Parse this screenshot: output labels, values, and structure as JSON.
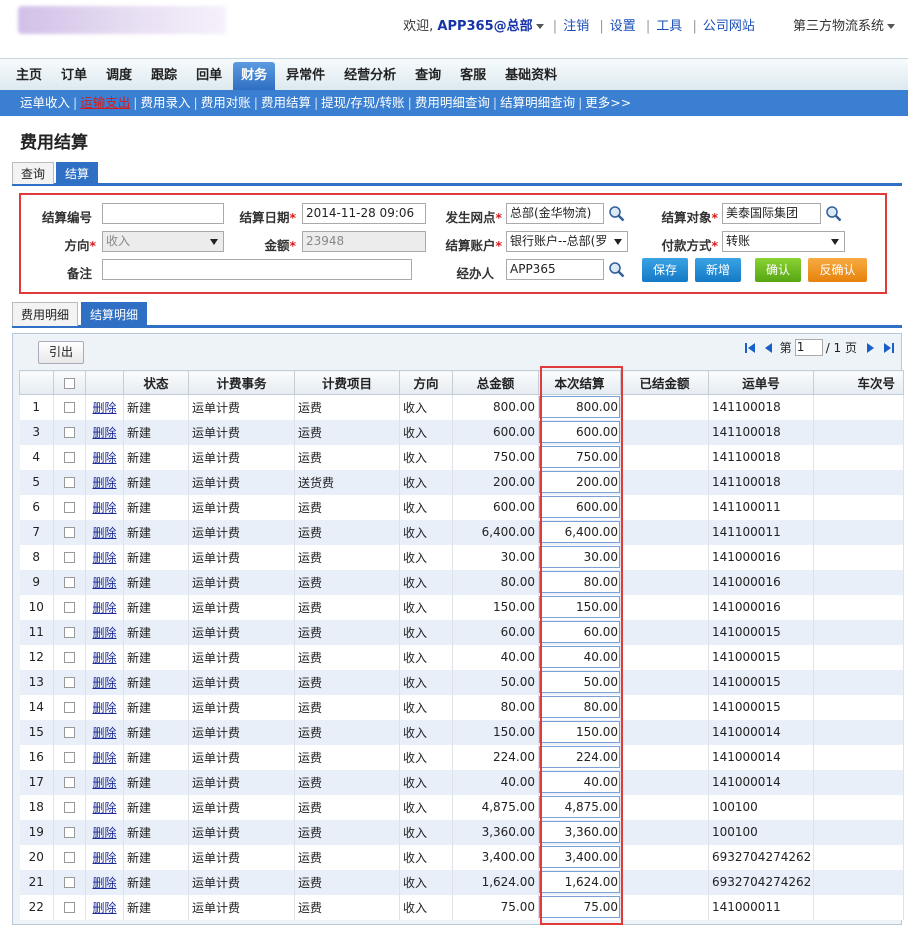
{
  "header": {
    "welcome": "欢迎,",
    "user": "APP365@总部",
    "links": [
      "注销",
      "设置",
      "工具",
      "公司网站"
    ],
    "system_menu": "第三方物流系统"
  },
  "nav": {
    "items": [
      "主页",
      "订单",
      "调度",
      "跟踪",
      "回单",
      "财务",
      "异常件",
      "经营分析",
      "查询",
      "客服",
      "基础资料"
    ],
    "active": "财务"
  },
  "subnav": {
    "items": [
      "运单收入",
      "运输支出",
      "费用录入",
      "费用对账",
      "费用结算",
      "提现/存现/转账",
      "费用明细查询",
      "结算明细查询"
    ],
    "active": "运输支出",
    "more": "更多>>"
  },
  "page_title": "费用结算",
  "tabs_top": [
    "查询",
    "结算"
  ],
  "form": {
    "settle_no": {
      "label": "结算编号",
      "value": ""
    },
    "settle_date": {
      "label": "结算日期",
      "value": "2014-11-28 09:06"
    },
    "branch": {
      "label": "发生网点",
      "value": "总部(金华物流)"
    },
    "target": {
      "label": "结算对象",
      "value": "美泰国际集团"
    },
    "direction": {
      "label": "方向",
      "value": "收入"
    },
    "amount": {
      "label": "金额",
      "value": "23948"
    },
    "account": {
      "label": "结算账户",
      "value": "银行账户--总部(罗"
    },
    "pay_method": {
      "label": "付款方式",
      "value": "转账"
    },
    "remark": {
      "label": "备注",
      "value": ""
    },
    "handler": {
      "label": "经办人",
      "value": "APP365"
    },
    "buttons": {
      "save": "保存",
      "add": "新增",
      "confirm": "确认",
      "unconfirm": "反确认"
    }
  },
  "tabs_bottom": [
    "费用明细",
    "结算明细"
  ],
  "grid": {
    "export_label": "引出",
    "pager": {
      "prefix": "第",
      "page": "1",
      "suffix": "/ 1 页"
    },
    "columns": [
      "状态",
      "计费事务",
      "计费项目",
      "方向",
      "总金额",
      "本次结算",
      "已结金额",
      "运单号",
      "车次号"
    ],
    "delete_label": "删除",
    "rows": [
      [
        "1",
        "新建",
        "运单计费",
        "运费",
        "收入",
        "800.00",
        "800.00",
        "",
        "141100018"
      ],
      [
        "3",
        "新建",
        "运单计费",
        "运费",
        "收入",
        "600.00",
        "600.00",
        "",
        "141100018"
      ],
      [
        "4",
        "新建",
        "运单计费",
        "运费",
        "收入",
        "750.00",
        "750.00",
        "",
        "141100018"
      ],
      [
        "5",
        "新建",
        "运单计费",
        "送货费",
        "收入",
        "200.00",
        "200.00",
        "",
        "141100018"
      ],
      [
        "6",
        "新建",
        "运单计费",
        "运费",
        "收入",
        "600.00",
        "600.00",
        "",
        "141100011"
      ],
      [
        "7",
        "新建",
        "运单计费",
        "运费",
        "收入",
        "6,400.00",
        "6,400.00",
        "",
        "141100011"
      ],
      [
        "8",
        "新建",
        "运单计费",
        "运费",
        "收入",
        "30.00",
        "30.00",
        "",
        "141000016"
      ],
      [
        "9",
        "新建",
        "运单计费",
        "运费",
        "收入",
        "80.00",
        "80.00",
        "",
        "141000016"
      ],
      [
        "10",
        "新建",
        "运单计费",
        "运费",
        "收入",
        "150.00",
        "150.00",
        "",
        "141000016"
      ],
      [
        "11",
        "新建",
        "运单计费",
        "运费",
        "收入",
        "60.00",
        "60.00",
        "",
        "141000015"
      ],
      [
        "12",
        "新建",
        "运单计费",
        "运费",
        "收入",
        "40.00",
        "40.00",
        "",
        "141000015"
      ],
      [
        "13",
        "新建",
        "运单计费",
        "运费",
        "收入",
        "50.00",
        "50.00",
        "",
        "141000015"
      ],
      [
        "14",
        "新建",
        "运单计费",
        "运费",
        "收入",
        "80.00",
        "80.00",
        "",
        "141000015"
      ],
      [
        "15",
        "新建",
        "运单计费",
        "运费",
        "收入",
        "150.00",
        "150.00",
        "",
        "141000014"
      ],
      [
        "16",
        "新建",
        "运单计费",
        "运费",
        "收入",
        "224.00",
        "224.00",
        "",
        "141000014"
      ],
      [
        "17",
        "新建",
        "运单计费",
        "运费",
        "收入",
        "40.00",
        "40.00",
        "",
        "141000014"
      ],
      [
        "18",
        "新建",
        "运单计费",
        "运费",
        "收入",
        "4,875.00",
        "4,875.00",
        "",
        "100100"
      ],
      [
        "19",
        "新建",
        "运单计费",
        "运费",
        "收入",
        "3,360.00",
        "3,360.00",
        "",
        "100100"
      ],
      [
        "20",
        "新建",
        "运单计费",
        "运费",
        "收入",
        "3,400.00",
        "3,400.00",
        "",
        "6932704274262"
      ],
      [
        "21",
        "新建",
        "运单计费",
        "运费",
        "收入",
        "1,624.00",
        "1,624.00",
        "",
        "6932704274262"
      ],
      [
        "22",
        "新建",
        "运单计费",
        "运费",
        "收入",
        "75.00",
        "75.00",
        "",
        "141000011"
      ]
    ]
  }
}
